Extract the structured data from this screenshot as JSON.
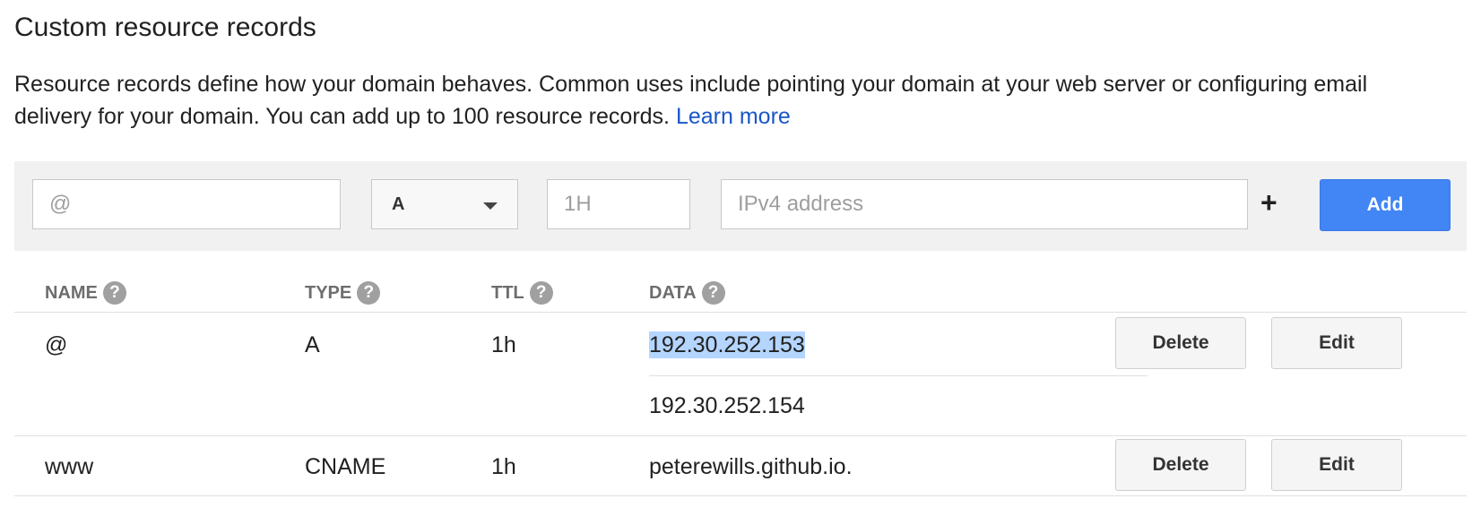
{
  "section": {
    "title": "Custom resource records",
    "description": "Resource records define how your domain behaves. Common uses include pointing your domain at your web server or configuring email delivery for your domain. You can add up to 100 resource records.",
    "learn_more": "Learn more"
  },
  "add_form": {
    "name_placeholder": "@",
    "type_value": "A",
    "ttl_placeholder": "1H",
    "data_placeholder": "IPv4 address",
    "plus_label": "+",
    "add_label": "Add"
  },
  "columns": [
    {
      "label": "NAME",
      "help": "?"
    },
    {
      "label": "TYPE",
      "help": "?"
    },
    {
      "label": "TTL",
      "help": "?"
    },
    {
      "label": "DATA",
      "help": "?"
    }
  ],
  "records": [
    {
      "name": "@",
      "type": "A",
      "ttl": "1h",
      "data": [
        "192.30.252.153",
        "192.30.252.154"
      ],
      "delete_label": "Delete",
      "edit_label": "Edit"
    },
    {
      "name": "www",
      "type": "CNAME",
      "ttl": "1h",
      "data": [
        "peterewills.github.io."
      ],
      "delete_label": "Delete",
      "edit_label": "Edit"
    }
  ],
  "colors": {
    "link": "#1a56c7",
    "primary_button": "#4285f4",
    "panel_background": "#f1f1f1",
    "selection_highlight": "#b4d5fe"
  }
}
